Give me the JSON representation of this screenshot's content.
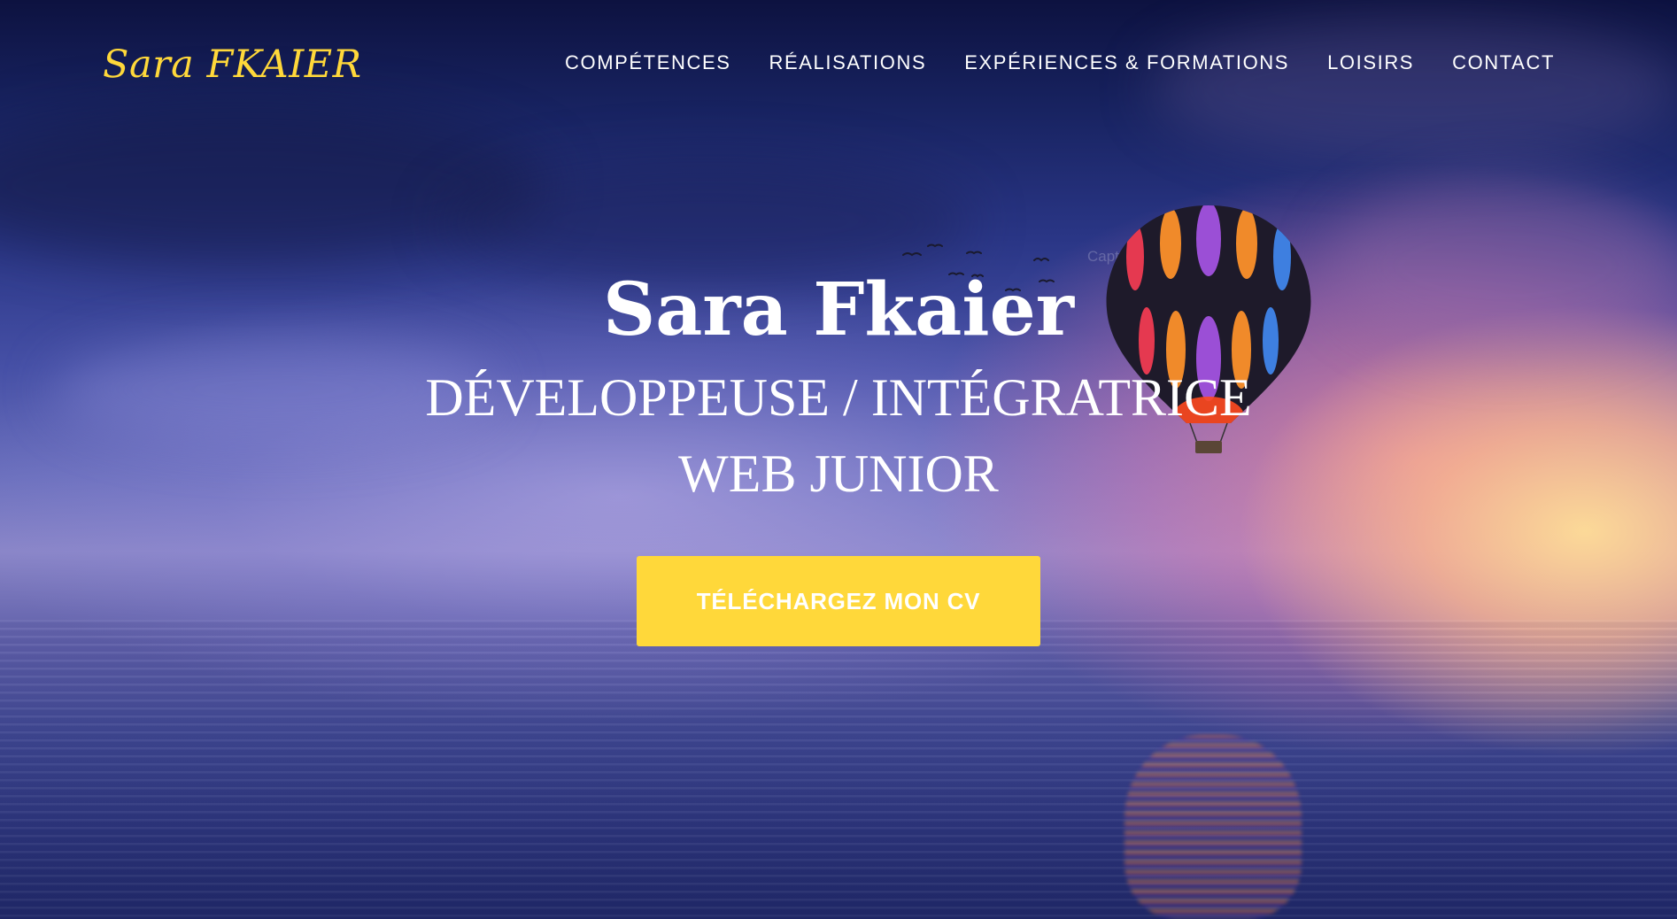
{
  "header": {
    "logo": "Sara FKAIER",
    "nav": [
      {
        "label": "COMPÉTENCES"
      },
      {
        "label": "RÉALISATIONS"
      },
      {
        "label": "EXPÉRIENCES & FORMATIONS"
      },
      {
        "label": "LOISIRS"
      },
      {
        "label": "CONTACT"
      }
    ]
  },
  "hero": {
    "name": "Sara Fkaier",
    "role_line1": "DÉVELOPPEUSE / INTÉGRATRICE",
    "role_line2": "WEB JUNIOR",
    "cta_label": "TÉLÉCHARGEZ MON CV",
    "overlay_label": "Capture rectangulaire"
  },
  "colors": {
    "accent": "#ffd83a",
    "text": "#ffffff",
    "sky_top": "#0d1240",
    "sunset": "#ffd896"
  },
  "icons": {
    "balloon": "hot-air-balloon-icon",
    "birds": "birds-icon"
  }
}
